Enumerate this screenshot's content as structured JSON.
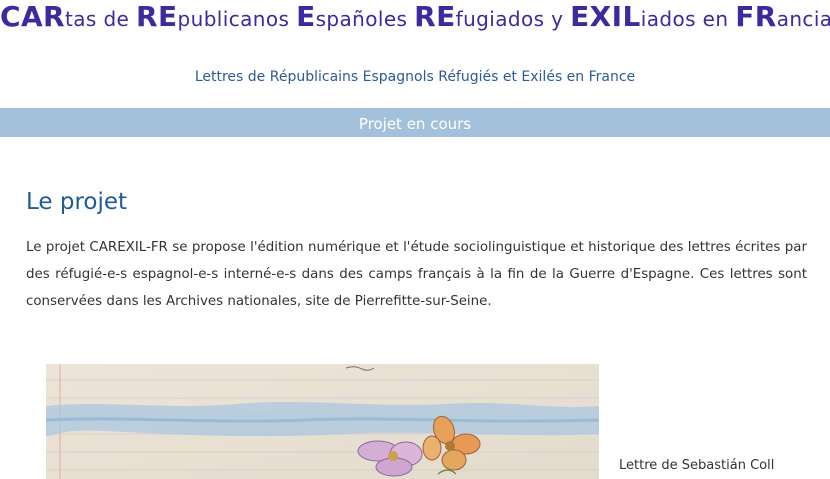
{
  "header": {
    "title_segments": [
      {
        "text": "CAR",
        "big": true
      },
      {
        "text": "tas de ",
        "big": false
      },
      {
        "text": "RE",
        "big": true
      },
      {
        "text": "publicanos ",
        "big": false
      },
      {
        "text": "E",
        "big": true
      },
      {
        "text": "spañoles ",
        "big": false
      },
      {
        "text": "RE",
        "big": true
      },
      {
        "text": "fugiados y ",
        "big": false
      },
      {
        "text": "EXIL",
        "big": true
      },
      {
        "text": "iados en ",
        "big": false
      },
      {
        "text": "FR",
        "big": true
      },
      {
        "text": "ancia",
        "big": false
      }
    ],
    "subtitle": "Lettres de Républicains Espagnols Réfugiés et Exilés en France",
    "status": "Projet en cours"
  },
  "main": {
    "section_title": "Le projet",
    "intro": "Le projet CAREXIL-FR se propose l'édition numérique et l'étude sociolinguistique et historique des lettres écrites par des réfugié-e-s espagnol-e-s interné-e-s dans des camps français à la fin de la Guerre d'Espagne. Ces lettres sont conservées dans les Archives nationales, site de Pierrefitte-sur-Seine.",
    "image_caption": "Lettre de Sebastián Coll"
  },
  "colors": {
    "title": "#3b2b9e",
    "subtitle": "#2d5b96",
    "status_bar": "#a4c1dc",
    "section_title": "#1f5b97",
    "body_text": "#333333"
  }
}
